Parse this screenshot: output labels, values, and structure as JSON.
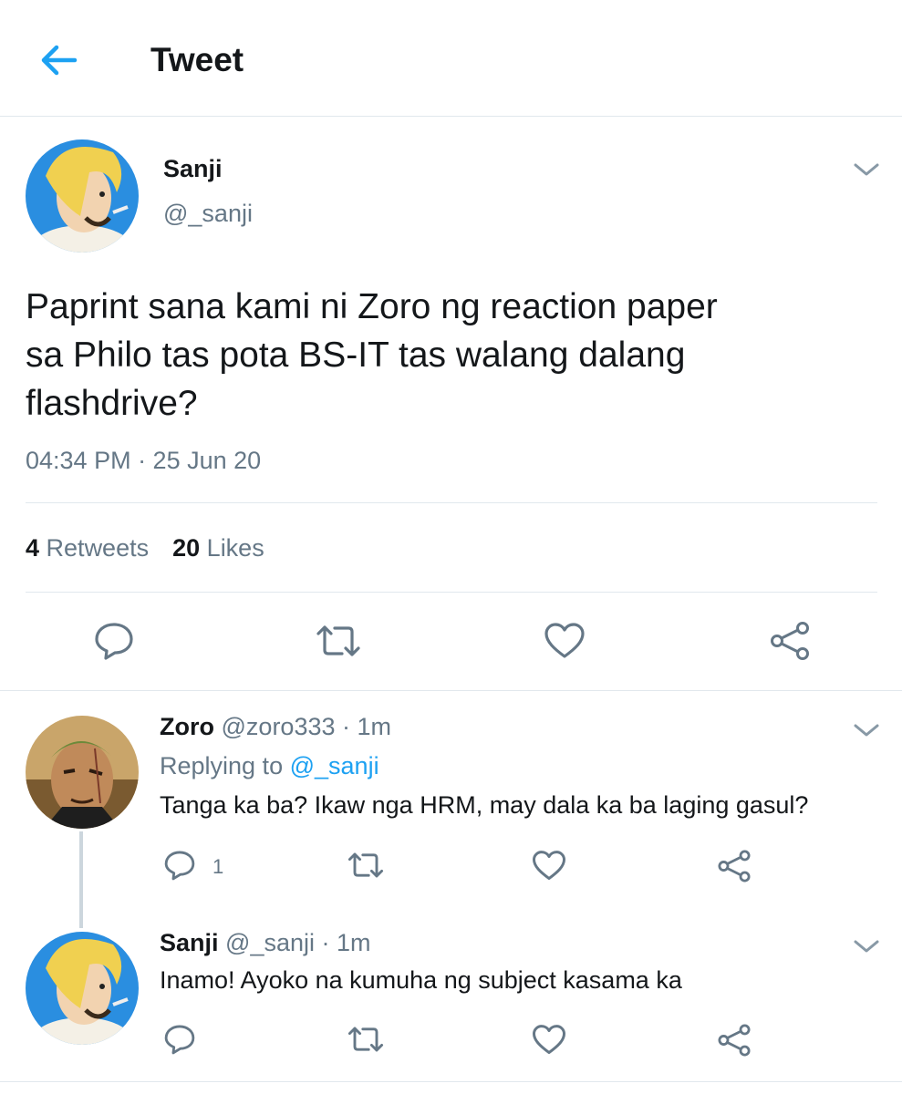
{
  "header": {
    "title": "Tweet",
    "back_icon": "arrow-left-icon",
    "accent": "#1da1f2"
  },
  "main_tweet": {
    "name": "Sanji",
    "handle": "@_sanji",
    "text_lines": [
      "Paprint sana kami ni Zoro ng reaction paper",
      "sa Philo tas pota BS-IT tas walang dalang",
      "flashdrive?"
    ],
    "timestamp": "04:34 PM · 25 Jun 20",
    "stats": {
      "retweets_count": "4",
      "retweets_label": "Retweets",
      "likes_count": "20",
      "likes_label": "Likes"
    },
    "actions": [
      "reply-icon",
      "retweet-icon",
      "like-icon",
      "share-icon"
    ]
  },
  "replies": [
    {
      "name": "Zoro",
      "meta": "@zoro333 · 1m",
      "replying_prefix": "Replying to",
      "replying_handle": "@_sanji",
      "text": "Tanga ka ba? Ikaw nga HRM, may dala ka ba laging gasul?",
      "reply_count": "1"
    },
    {
      "name": "Sanji",
      "meta": "@_sanji · 1m",
      "text": "Inamo! Ayoko na kumuha ng subject kasama ka"
    }
  ],
  "colors": {
    "text": "#14171a",
    "secondary": "#657786",
    "link": "#1da1f2",
    "divider": "#e1e8ed"
  }
}
